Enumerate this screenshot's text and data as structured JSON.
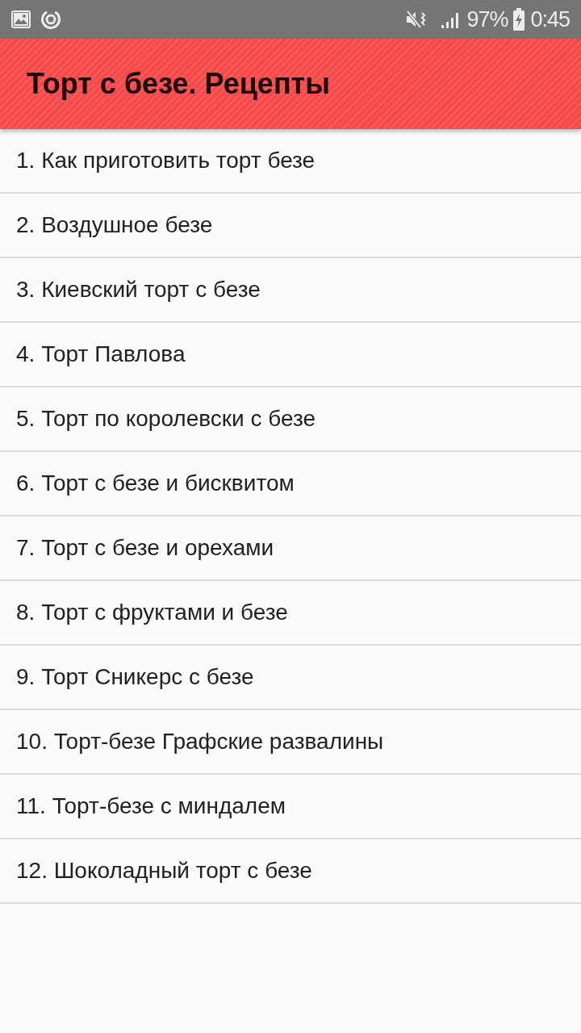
{
  "status_bar": {
    "battery": "97%",
    "time": "0:45"
  },
  "app_bar": {
    "title": "Торт с безе. Рецепты"
  },
  "recipes": [
    {
      "label": "1. Как приготовить торт безе"
    },
    {
      "label": "2. Воздушное безе"
    },
    {
      "label": "3. Киевский торт с безе"
    },
    {
      "label": "4. Торт Павлова"
    },
    {
      "label": "5. Торт по королевски с безе"
    },
    {
      "label": "6. Торт с безе и бисквитом"
    },
    {
      "label": "7. Торт с безе и орехами"
    },
    {
      "label": "8. Торт с фруктами и безе"
    },
    {
      "label": "9. Торт Сникерс с безе"
    },
    {
      "label": "10. Торт-безе Графские развалины"
    },
    {
      "label": "11. Торт-безе с миндалем"
    },
    {
      "label": "12. Шоколадный торт с безе"
    }
  ]
}
